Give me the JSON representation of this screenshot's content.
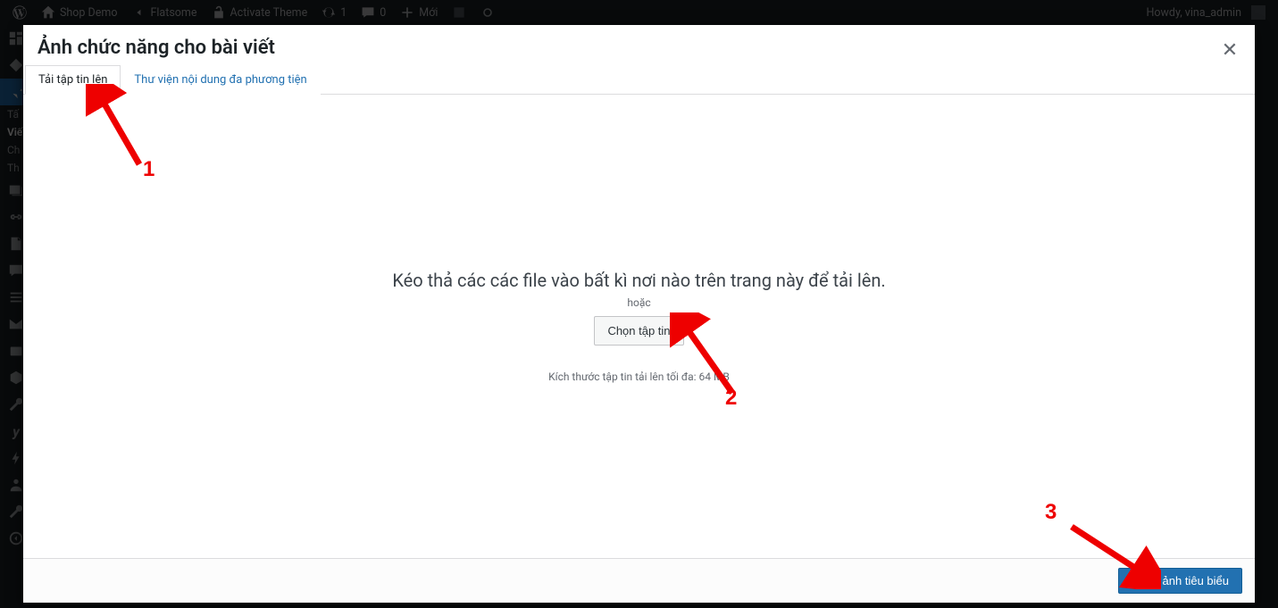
{
  "adminbar": {
    "site_name": "Shop Demo",
    "theme": "Flatsome",
    "activate": "Activate Theme",
    "updates": "1",
    "comments": "0",
    "new": "Mới",
    "howdy": "Howdy, vina_admin"
  },
  "sidemenu": {
    "sub_all": "Tấ",
    "sub_new": "Viế",
    "sub_cat": "Ch",
    "sub_tag": "Th"
  },
  "modal": {
    "title": "Ảnh chức năng cho bài viết",
    "tabs": {
      "upload": "Tải tập tin lên",
      "library": "Thư viện nội dung đa phương tiện"
    },
    "drop_heading": "Kéo thả các các file vào bất kì nơi nào trên trang này để tải lên.",
    "drop_or": "hoặc",
    "choose_file": "Chọn tập tin",
    "size_hint": "Kích thước tập tin tải lên tối đa: 64 MB",
    "submit": "Chọn ảnh tiêu biểu"
  },
  "annotations": {
    "a1": "1",
    "a2": "2",
    "a3": "3"
  }
}
